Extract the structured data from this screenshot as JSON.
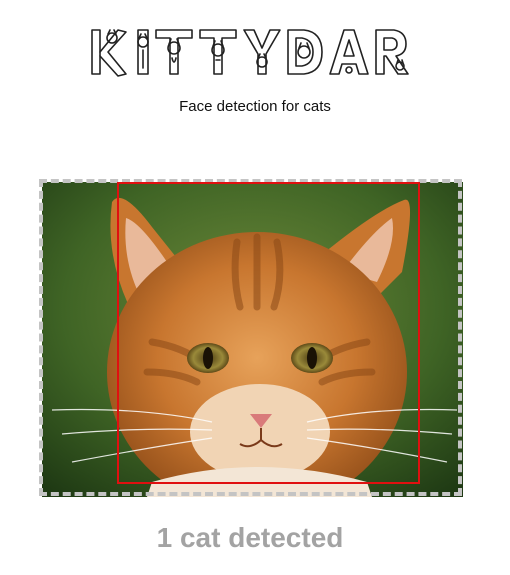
{
  "header": {
    "logo_text": "KITTYDAR",
    "subtitle": "Face detection for cats"
  },
  "dropzone": {
    "image_label": "cat-photo"
  },
  "result": {
    "status": "1 cat detected"
  },
  "colors": {
    "detection_box": "#e01010",
    "dropzone_border": "#c4c4c4",
    "status_text": "#a3a3a3"
  }
}
